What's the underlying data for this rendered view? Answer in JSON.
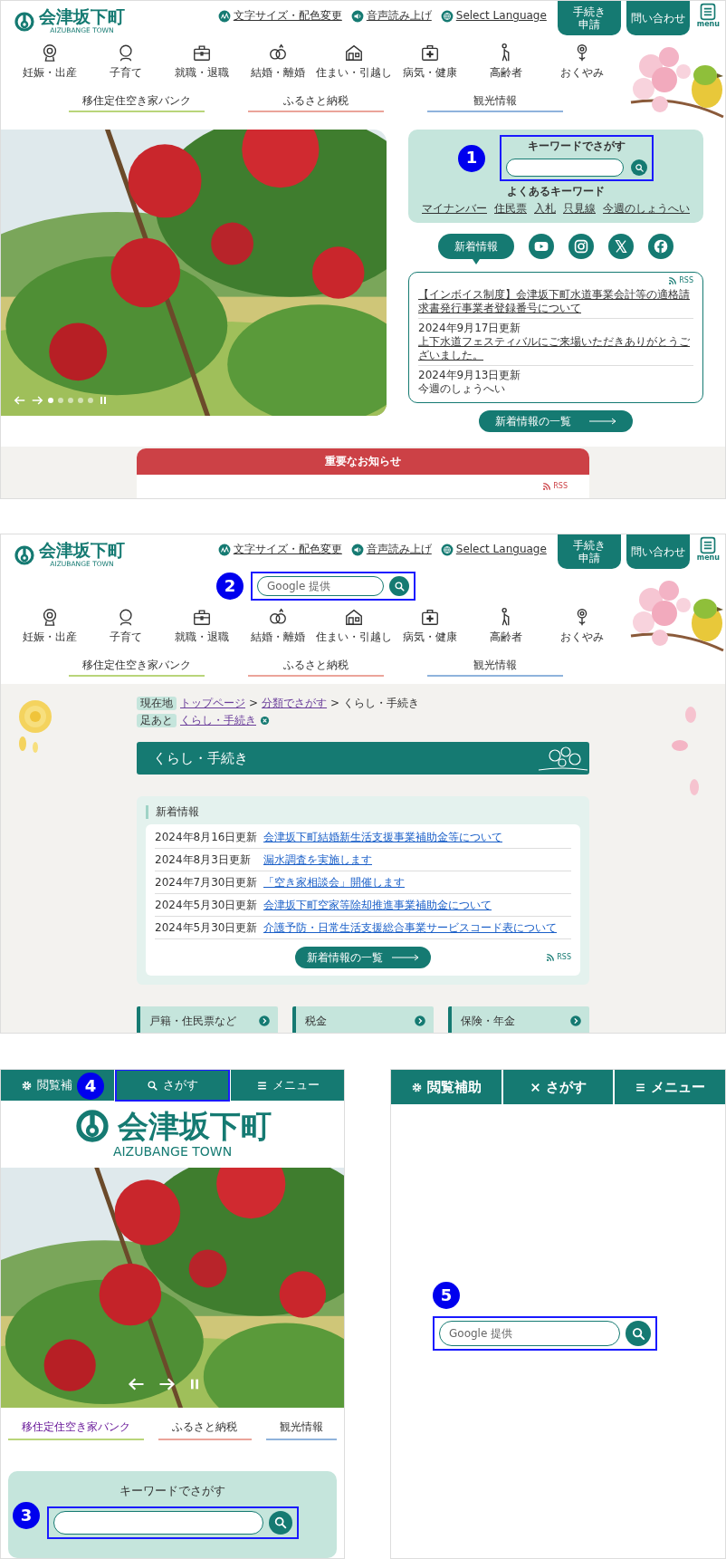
{
  "top_page": {
    "header": {
      "logo": {
        "name": "会津坂下町",
        "romaji": "AIZUBANGE TOWN"
      },
      "utility_links": [
        {
          "kind": "text-size",
          "label": "文字サイズ・配色変更"
        },
        {
          "kind": "voice",
          "label": "音声読み上げ"
        },
        {
          "kind": "language",
          "label": "Select Language"
        }
      ],
      "buttons": [
        {
          "lines": [
            "手続き",
            "申請"
          ]
        },
        {
          "lines": [
            "問い合わせ"
          ]
        }
      ],
      "menu": "menu",
      "life_events": [
        {
          "kind": "pregnancy",
          "label": "妊娠・出産"
        },
        {
          "kind": "childcare",
          "label": "子育て"
        },
        {
          "kind": "employment",
          "label": "就職・退職"
        },
        {
          "kind": "marriage",
          "label": "結婚・離婚"
        },
        {
          "kind": "housing",
          "label": "住まい・引越し"
        },
        {
          "kind": "health",
          "label": "病気・健康"
        },
        {
          "kind": "elderly",
          "label": "高齢者"
        },
        {
          "kind": "bereavement",
          "label": "おくやみ"
        }
      ],
      "featured_links": [
        {
          "label": "移住定住空き家バンク",
          "color": "#b9d57a"
        },
        {
          "label": "ふるさと納税",
          "color": "#eba49a"
        },
        {
          "label": "観光情報",
          "color": "#8fb3dc"
        }
      ]
    },
    "hero": {
      "kind": "picture",
      "slides": [
        {
          "selected": true
        },
        {
          "selected": false
        },
        {
          "selected": false
        },
        {
          "selected": false
        },
        {
          "selected": false
        }
      ]
    },
    "keyword_search": {
      "marker": "1",
      "title": "キーワードでさがす",
      "popular_title": "よくあるキーワード",
      "popular": [
        "マイナンバー",
        "住民票",
        "入札",
        "只見線",
        "今週のしょうへい"
      ]
    },
    "tabs": [
      {
        "kind": "news",
        "label": "新着情報",
        "selected": true
      },
      {
        "kind": "youtube",
        "selected": false
      },
      {
        "kind": "instagram",
        "selected": false
      },
      {
        "kind": "x",
        "selected": false
      },
      {
        "kind": "facebook",
        "selected": false
      }
    ],
    "news": {
      "rss": "RSS",
      "items": [
        {
          "title": "【インボイス制度】会津坂下町水道事業会計等の適格請求書発行事業者登録番号について",
          "link": true
        },
        {
          "date": "2024年9月17日更新",
          "title": "上下水道フェスティバルにご来場いただきありがとうございました。",
          "link": true
        },
        {
          "date": "2024年9月13日更新",
          "title": "今週のしょうへい",
          "link": false
        }
      ]
    },
    "news_list_button": "新着情報の一覧",
    "notice": {
      "title": "重要なお知らせ",
      "rss": "RSS"
    }
  },
  "category_page": {
    "header": {
      "logo": {
        "name": "会津坂下町",
        "romaji": "AIZUBANGE TOWN"
      },
      "utility_links": [
        {
          "kind": "text-size",
          "label": "文字サイズ・配色変更"
        },
        {
          "kind": "voice",
          "label": "音声読み上げ"
        },
        {
          "kind": "language",
          "label": "Select Language"
        }
      ],
      "buttons": [
        {
          "lines": [
            "手続き",
            "申請"
          ]
        },
        {
          "lines": [
            "問い合わせ"
          ]
        }
      ],
      "menu": "menu",
      "site_search": {
        "marker": "2",
        "placeholder": "Google 提供"
      },
      "life_events": [
        {
          "kind": "pregnancy",
          "label": "妊娠・出産"
        },
        {
          "kind": "childcare",
          "label": "子育て"
        },
        {
          "kind": "employment",
          "label": "就職・退職"
        },
        {
          "kind": "marriage",
          "label": "結婚・離婚"
        },
        {
          "kind": "housing",
          "label": "住まい・引越し"
        },
        {
          "kind": "health",
          "label": "病気・健康"
        },
        {
          "kind": "elderly",
          "label": "高齢者"
        },
        {
          "kind": "bereavement",
          "label": "おくやみ"
        }
      ],
      "featured_links": [
        {
          "label": "移住定住空き家バンク",
          "color": "#b9d57a"
        },
        {
          "label": "ふるさと納税",
          "color": "#eba49a"
        },
        {
          "label": "観光情報",
          "color": "#8fb3dc"
        }
      ]
    },
    "breadcrumb": {
      "label": "現在地",
      "separator": ">",
      "items": [
        {
          "label": "トップページ",
          "link": true
        },
        {
          "label": "分類でさがす",
          "link": true
        },
        {
          "label": "くらし・手続き",
          "link": false
        }
      ]
    },
    "history": {
      "label": "足あと",
      "items": [
        "くらし・手続き"
      ]
    },
    "title": "くらし・手続き",
    "news": {
      "title": "新着情報",
      "items": [
        {
          "date": "2024年8月16日更新",
          "title": "会津坂下町結婚新生活支援事業補助金等について"
        },
        {
          "date": "2024年8月3日更新",
          "title": "漏水調査を実施します"
        },
        {
          "date": "2024年7月30日更新",
          "title": "「空き家相談会」開催します"
        },
        {
          "date": "2024年5月30日更新",
          "title": "会津坂下町空家等除却推進事業補助金について"
        },
        {
          "date": "2024年5月30日更新",
          "title": "介護予防・日常生活支援総合事業サービスコード表について"
        }
      ],
      "button": "新着情報の一覧",
      "rss": "RSS"
    },
    "categories": [
      "戸籍・住民票など",
      "税金",
      "保険・年金"
    ]
  },
  "mobile_search_closed": {
    "toolbar": [
      {
        "kind": "accessibility",
        "label": "閲覧補"
      },
      {
        "kind": "search",
        "label": "さがす",
        "marker": "4"
      },
      {
        "kind": "menu",
        "label": "メニュー"
      }
    ],
    "logo": {
      "name": "会津坂下町",
      "romaji": "AIZUBANGE TOWN"
    },
    "featured_links": [
      {
        "label": "移住定住空き家バンク",
        "color": "#b9d57a",
        "visited": true
      },
      {
        "label": "ふるさと納税",
        "color": "#eba49a",
        "visited": false
      },
      {
        "label": "観光情報",
        "color": "#8fb3dc",
        "visited": false
      }
    ],
    "keyword_search": {
      "marker": "3",
      "title": "キーワードでさがす"
    }
  },
  "mobile_search_open": {
    "toolbar": [
      {
        "kind": "accessibility",
        "label": "閲覧補助"
      },
      {
        "kind": "close",
        "label": "さがす"
      },
      {
        "kind": "menu",
        "label": "メニュー"
      }
    ],
    "site_search": {
      "marker": "5",
      "placeholder": "Google 提供"
    }
  }
}
